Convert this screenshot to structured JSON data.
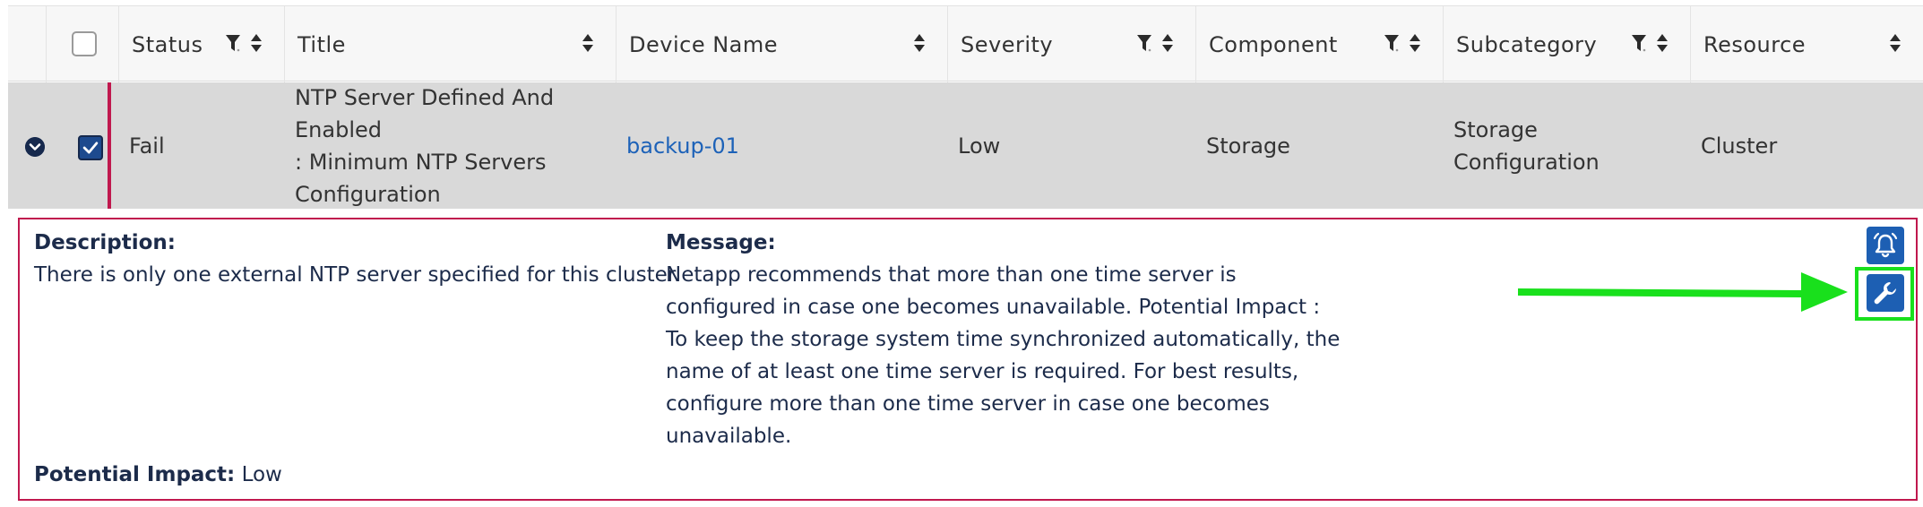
{
  "table": {
    "columns": [
      {
        "label": "",
        "icons": []
      },
      {
        "label": "",
        "icons": []
      },
      {
        "label": "Status",
        "icons": [
          "filter-icon",
          "sort-icon"
        ]
      },
      {
        "label": "Title",
        "icons": [
          "sort-icon"
        ]
      },
      {
        "label": "Device Name",
        "icons": [
          "sort-icon"
        ]
      },
      {
        "label": "Severity",
        "icons": [
          "filter-icon",
          "sort-icon"
        ]
      },
      {
        "label": "Component",
        "icons": [
          "filter-icon",
          "sort-icon"
        ]
      },
      {
        "label": "Subcategory",
        "icons": [
          "filter-icon",
          "sort-icon"
        ]
      },
      {
        "label": "Resource",
        "icons": [
          "sort-icon"
        ]
      }
    ],
    "row": {
      "selected": true,
      "expanded": true,
      "status": "Fail",
      "title_lines": [
        "NTP Server Defined And Enabled",
        ": Minimum NTP Servers",
        "Configuration"
      ],
      "device_name": "backup-01",
      "severity": "Low",
      "component": "Storage",
      "subcategory": "Storage Configuration",
      "resource": "Cluster"
    }
  },
  "details": {
    "description_label": "Description:",
    "description_text": "There is only one external NTP server specified for this cluster.",
    "message_label": "Message:",
    "message_lines": [
      "Netapp recommends that more than one time server is",
      "configured in case one becomes unavailable. Potential Impact :",
      "To keep the storage system time synchronized automatically, the",
      "name of at least one time server is required. For best results,",
      "configure more than one time server in case one becomes",
      "unavailable."
    ],
    "impact_label": "Potential Impact:",
    "impact_value": "Low",
    "actions": [
      {
        "icon": "alarm-bell-icon"
      },
      {
        "icon": "wrench-icon"
      }
    ]
  },
  "colors": {
    "accent": "#c0184e",
    "button_blue": "#1d5fb3",
    "link_blue": "#1d62b8",
    "highlight_green": "#19e01c",
    "row_bg": "#d9d9d9"
  }
}
